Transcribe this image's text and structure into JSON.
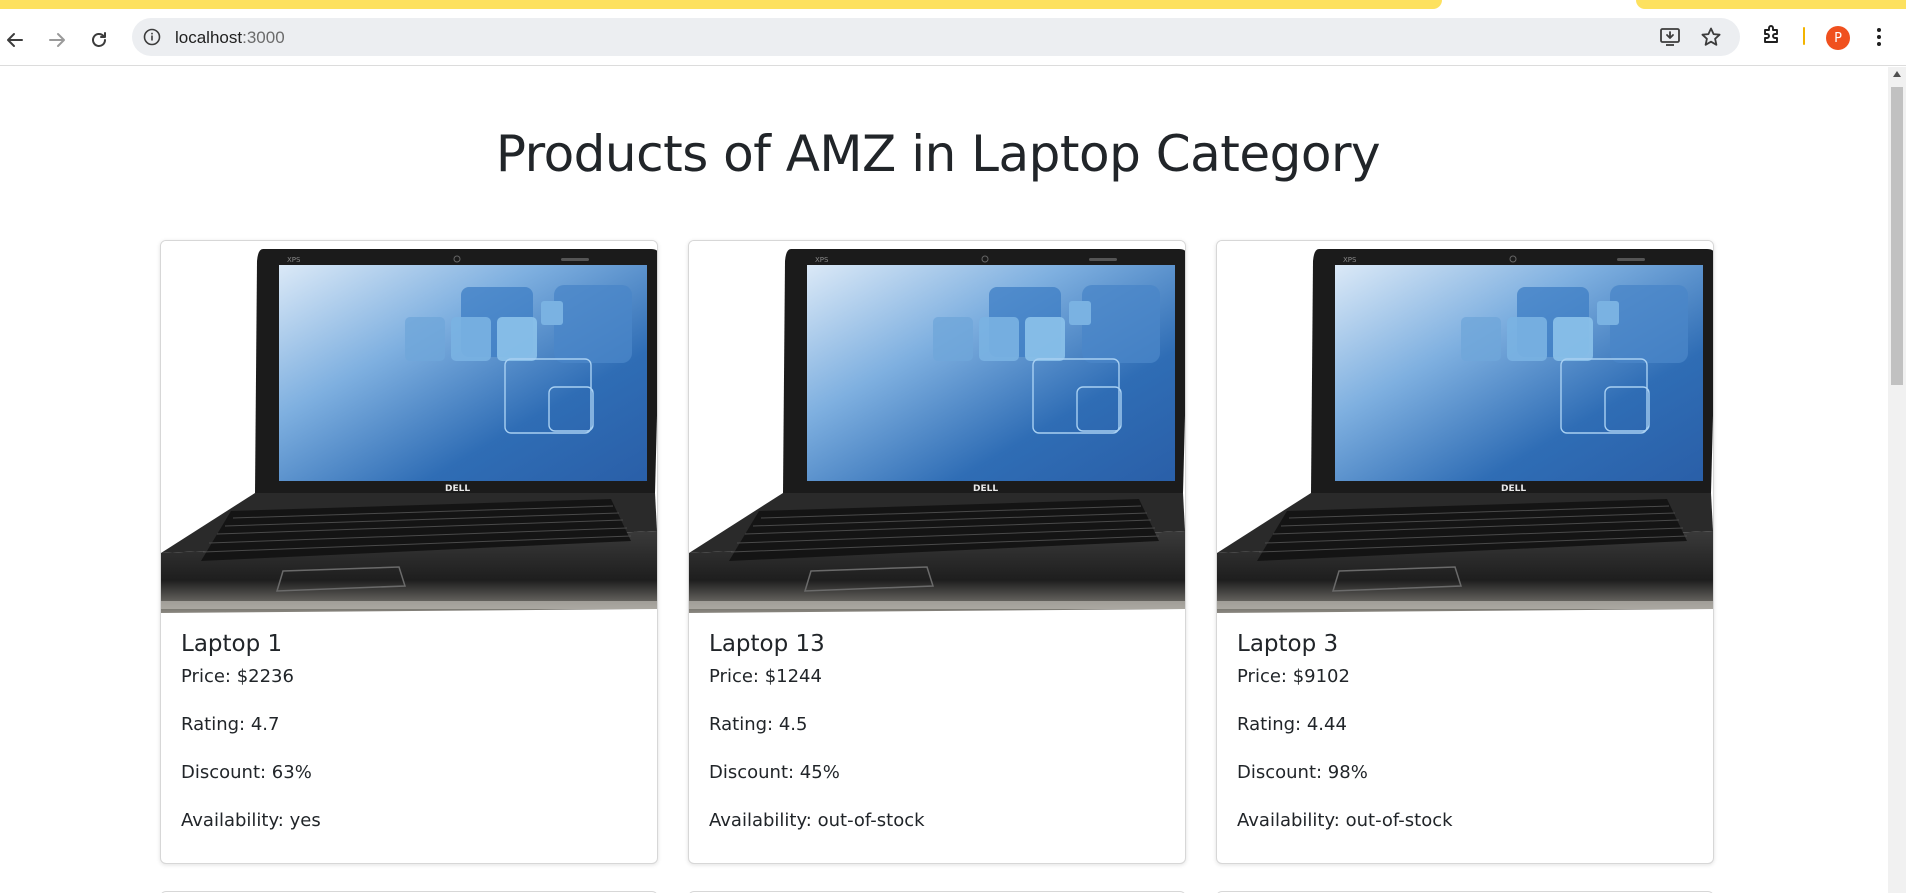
{
  "browser": {
    "url_host": "localhost",
    "url_port": ":3000",
    "profile_initial": "P"
  },
  "page": {
    "title": "Products of AMZ in Laptop Category"
  },
  "products": [
    {
      "name": "Laptop 1",
      "price": "Price: $2236",
      "rating": "Rating: 4.7",
      "discount": "Discount: 63%",
      "availability": "Availability: yes"
    },
    {
      "name": "Laptop 13",
      "price": "Price: $1244",
      "rating": "Rating: 4.5",
      "discount": "Discount: 45%",
      "availability": "Availability: out-of-stock"
    },
    {
      "name": "Laptop 3",
      "price": "Price: $9102",
      "rating": "Rating: 4.44",
      "discount": "Discount: 98%",
      "availability": "Availability: out-of-stock"
    }
  ],
  "image": {
    "brand": "DELL",
    "model": "XPS"
  },
  "colors": {
    "tab_accent": "#fde15f",
    "profile_avatar": "#f0501e",
    "screen_blue": "#2f6db5"
  }
}
